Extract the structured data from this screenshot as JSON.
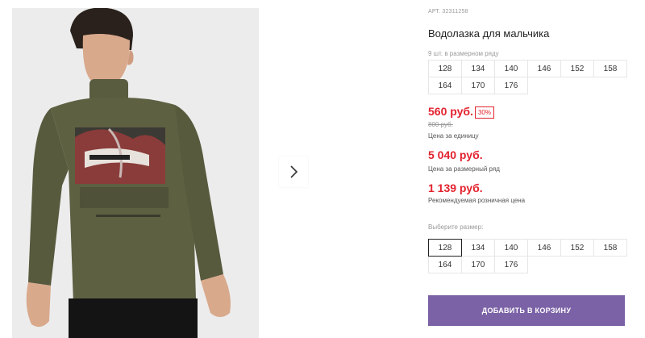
{
  "product": {
    "article": "АРТ. 32311258",
    "title": "Водолазка для мальчика",
    "row_note": "9 шт. в размерном ряду",
    "row_sizes": [
      "128",
      "134",
      "140",
      "146",
      "152",
      "158",
      "164",
      "170",
      "176"
    ],
    "price": "560 руб.",
    "discount": "30%",
    "old_price": "800 руб.",
    "unit_caption": "Цена за единицу",
    "row_price": "5 040 руб.",
    "row_caption": "Цена за размерный ряд",
    "retail_price": "1 139 руб.",
    "retail_caption": "Рекомендуемая розничная цена"
  },
  "size_select": {
    "label": "Выберите размер:",
    "options": [
      "128",
      "134",
      "140",
      "146",
      "152",
      "158",
      "164",
      "170",
      "176"
    ],
    "selected": "128"
  },
  "cart_button": "ДОБАВИТЬ В КОРЗИНУ",
  "gallery": {
    "next_icon": "chevron-right-icon"
  },
  "colors": {
    "price_red": "#e3222e",
    "cart_purple": "#7b62a6",
    "shirt_olive": "#5e6042"
  }
}
